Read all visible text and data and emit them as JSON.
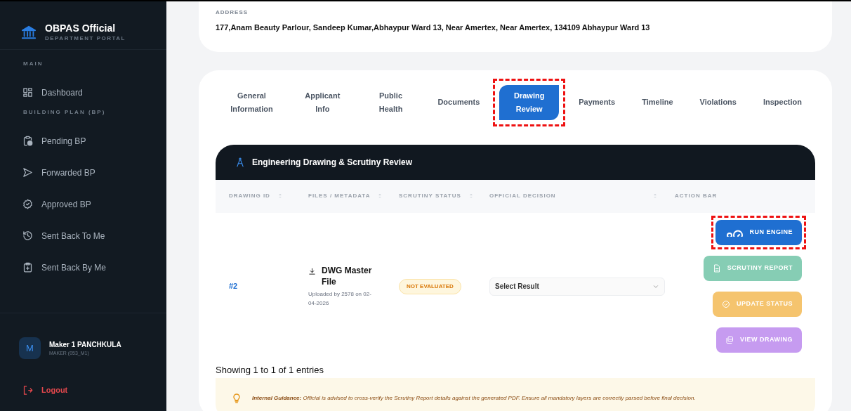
{
  "sidebar": {
    "brand": {
      "title": "OBPAS Official",
      "subtitle": "DEPARTMENT PORTAL"
    },
    "sections": [
      {
        "heading": "MAIN",
        "items": [
          {
            "label": "Dashboard",
            "selected": false
          }
        ]
      },
      {
        "heading": "BUILDING PLAN (BP)",
        "items": [
          {
            "label": "Pending BP",
            "selected": false
          },
          {
            "label": "Forwarded BP",
            "selected": false
          },
          {
            "label": "Approved BP",
            "selected": false
          },
          {
            "label": "Sent Back To Me",
            "selected": false
          },
          {
            "label": "Sent Back By Me",
            "selected": false
          }
        ]
      }
    ],
    "user": {
      "initial": "M",
      "name": "Maker 1 PANCHKULA",
      "role": "MAKER (053_M1)"
    },
    "logout": "Logout"
  },
  "address": {
    "label": "ADDRESS",
    "value": "177,Anam Beauty Parlour, Sandeep Kumar,Abhaypur Ward 13, Near Amertex, Near Amertex, 134109 Abhaypur Ward 13"
  },
  "tabs": [
    {
      "label": "General Information",
      "selected": false,
      "highlighted": false
    },
    {
      "label": "Applicant Info",
      "selected": false,
      "highlighted": false
    },
    {
      "label": "Public Health",
      "selected": false,
      "highlighted": false
    },
    {
      "label": "Documents",
      "selected": false,
      "highlighted": false
    },
    {
      "label": "Drawing Review",
      "selected": true,
      "highlighted": true
    },
    {
      "label": "Payments",
      "selected": false,
      "highlighted": false
    },
    {
      "label": "Timeline",
      "selected": false,
      "highlighted": false
    },
    {
      "label": "Violations",
      "selected": false,
      "highlighted": false
    },
    {
      "label": "Inspection",
      "selected": false,
      "highlighted": false
    }
  ],
  "panel": {
    "title": "Engineering Drawing & Scrutiny Review",
    "table": {
      "columns": [
        {
          "label": "DRAWING ID",
          "sortable": true
        },
        {
          "label": "FILES / METADATA",
          "sortable": true
        },
        {
          "label": "SCRUTINY STATUS",
          "sortable": true
        },
        {
          "label": "OFFICIAL DECISION",
          "sortable": true
        },
        {
          "label": "ACTION BAR",
          "sortable": false
        }
      ],
      "rows": [
        {
          "id": "#2",
          "file": {
            "name": "DWG Master File",
            "meta": "Uploaded by 2578 on 02-04-2026"
          },
          "status": "NOT EVALUATED",
          "decision": {
            "placeholder": "Select Result"
          },
          "actions": [
            {
              "label": "RUN ENGINE",
              "kind": "run",
              "color": "#1f6fd1",
              "highlighted": true
            },
            {
              "label": "SCRUTINY REPORT",
              "kind": "report",
              "color": "#86cdb4",
              "highlighted": false
            },
            {
              "label": "UPDATE STATUS",
              "kind": "status",
              "color": "#f5c46e",
              "highlighted": false
            },
            {
              "label": "VIEW DRAWING",
              "kind": "view",
              "color": "#c69bf0",
              "highlighted": false
            }
          ]
        }
      ]
    },
    "footer": "Showing 1 to 1 of 1 entries",
    "guidance": "**Internal Guidance:** Official is advised to cross-verify the Scrutiny Report details against the generated PDF. Ensure all mandatory layers are correctly parsed before final decision."
  }
}
